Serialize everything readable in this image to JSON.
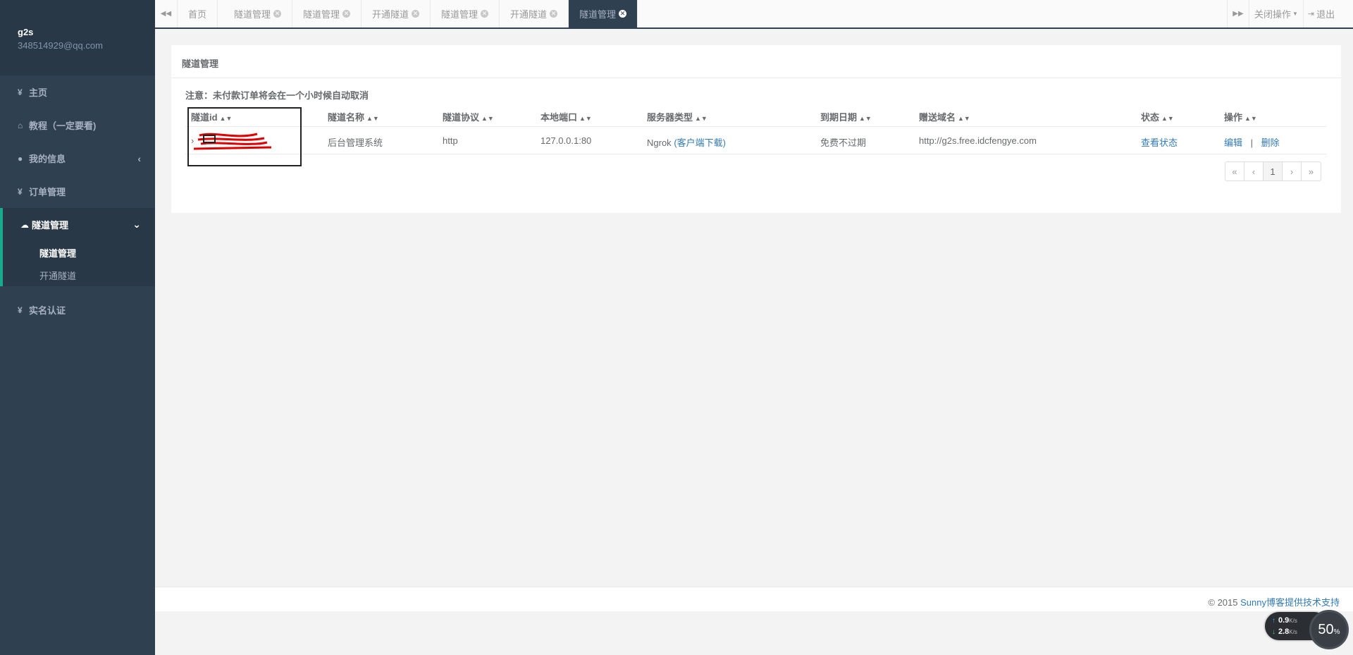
{
  "sidebar": {
    "user_name": "g2s",
    "user_email": "348514929@qq.com",
    "items": [
      {
        "icon": "yen-icon",
        "glyph": "¥",
        "label": "主页"
      },
      {
        "icon": "home-icon",
        "glyph": "⌂",
        "label": "教程（一定要看)"
      },
      {
        "icon": "user-icon",
        "glyph": "●",
        "label": "我的信息",
        "chevron": "‹"
      },
      {
        "icon": "yen-icon",
        "glyph": "¥",
        "label": "订单管理"
      },
      {
        "icon": "cloud-icon",
        "glyph": "☁",
        "label": "隧道管理",
        "chevron": "⌄"
      },
      {
        "icon": "yen-icon",
        "glyph": "¥",
        "label": "实名认证"
      }
    ],
    "sub_items": [
      "隧道管理",
      "开通隧道"
    ]
  },
  "topbar": {
    "back_glyph": "◀◀",
    "forward_glyph": "▶▶",
    "tabs": [
      "首页",
      "隧道管理",
      "隧道管理",
      "开通隧道",
      "隧道管理",
      "开通隧道",
      "隧道管理"
    ],
    "close_ops": "关闭操作",
    "logout": "退出"
  },
  "panel": {
    "title": "隧道管理",
    "notice": "注意：未付款订单将会在一个小时候自动取消",
    "columns": [
      "隧道id",
      "隧道名称",
      "隧道协议",
      "本地端口",
      "服务器类型",
      "到期日期",
      "赠送域名",
      "状态",
      "操作"
    ],
    "row": {
      "name": "后台管理系统",
      "protocol": "http",
      "port": "127.0.0.1:80",
      "server_type": "Ngrok",
      "client_download": "(客户端下载)",
      "expire": "免费不过期",
      "domain": "http://g2s.free.idcfengye.com",
      "status": "查看状态",
      "edit": "编辑",
      "sep": "|",
      "delete": "删除"
    },
    "pager": [
      "«",
      "‹",
      "1",
      "›",
      "»"
    ]
  },
  "footer": {
    "copyright": "© 2015 ",
    "link": "Sunny博客提供技术支持"
  },
  "net_widget": {
    "up": "0.9",
    "down": "2.8",
    "unit": "K/s",
    "percent": "50",
    "percent_sign": "%"
  },
  "colors": {
    "sidebar_bg": "#2f4050",
    "accent": "#19aa8d",
    "link": "#337ab7",
    "redact_mark": "#e00000"
  }
}
